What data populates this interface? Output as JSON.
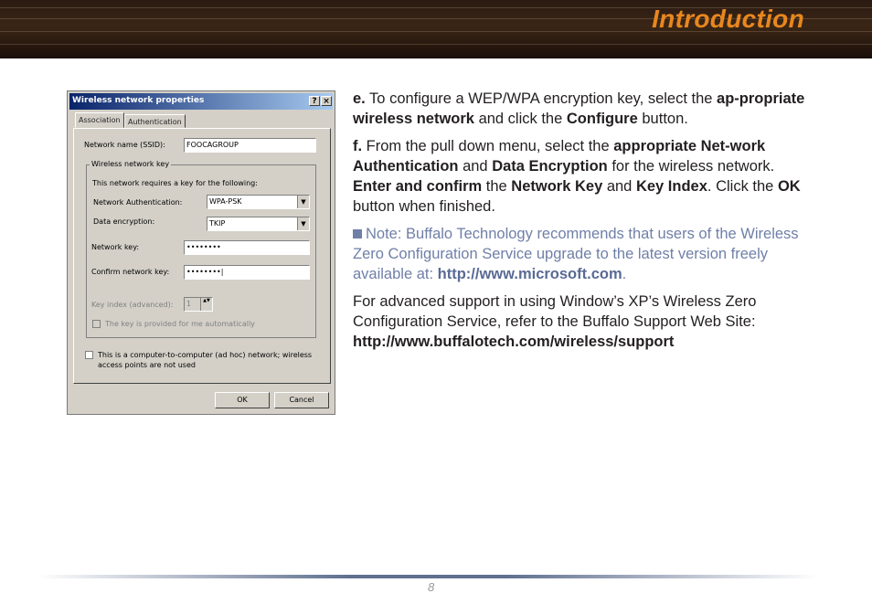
{
  "header": {
    "title": "Introduction"
  },
  "dialog": {
    "title": "Wireless network properties",
    "help_btn": "?",
    "close_btn": "×",
    "tabs": [
      "Association",
      "Authentication"
    ],
    "ssid_label": "Network name (SSID):",
    "ssid_value": "FOOCAGROUP",
    "group_label": "Wireless network key",
    "group_desc": "This network requires a key for the following:",
    "auth_label": "Network Authentication:",
    "auth_value": "WPA-PSK",
    "enc_label": "Data encryption:",
    "enc_value": "TKIP",
    "key_label": "Network key:",
    "key_value": "••••••••",
    "confirm_label": "Confirm network key:",
    "confirm_value": "••••••••|",
    "keyindex_label": "Key index (advanced):",
    "keyindex_value": "1",
    "auto_key_label": "The key is provided for me automatically",
    "adhoc_line1": "This is a computer-to-computer (ad hoc) network; wireless",
    "adhoc_line2": "access points are not used",
    "ok": "OK",
    "cancel": "Cancel",
    "dropdown_arrow": "▼",
    "spin_arrows": "▲▼"
  },
  "steps": {
    "e_letter": "e.",
    "e_1": " To configure a WEP/WPA encryption key, select the ",
    "e_b1": "ap-propriate wireless network",
    "e_2": " and click the ",
    "e_b2": "Configure",
    "e_3": " button.",
    "f_letter": "f.",
    "f_1": "  From the pull down menu, select the ",
    "f_b1": "appropriate Net-work Authentication",
    "f_2": " and ",
    "f_b2": "Data Encryption",
    "f_3": " for the wireless network.  ",
    "f_b3": "Enter and confirm",
    "f_4": " the ",
    "f_b4": "Network Key",
    "f_5": " and ",
    "f_b5": "Key Index",
    "f_6": ".  Click the ",
    "f_b6": "OK",
    "f_7": " button when finished."
  },
  "note": {
    "text": "Note: Buffalo Technology recommends that users of the Wireless Zero Configuration Service upgrade to the latest version freely available at: ",
    "link": "http://www.microsoft.com",
    "end": "."
  },
  "support": {
    "text": "For advanced support in using Window’s XP’s Wireless Zero Configuration Service, refer to the Buffalo Support Web Site: ",
    "link": "http://www.buffalotech.com/wireless/support"
  },
  "footer": {
    "page": "8"
  }
}
